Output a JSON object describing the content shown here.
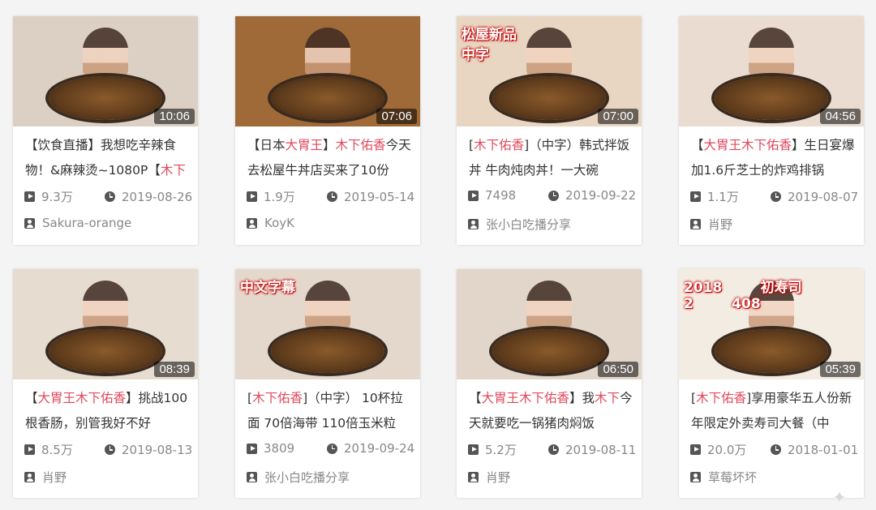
{
  "icons": {
    "views": "play-icon",
    "date": "clock-icon",
    "author": "user-icon"
  },
  "colors": {
    "highlight": "#e0475a",
    "text": "#333333",
    "meta": "#888888"
  },
  "videos": [
    {
      "thumb_bg": "#dcd0c4",
      "thumb_overlay": "",
      "duration": "10:06",
      "title_parts": [
        "【饮食直播】我想吃辛辣食物！&麻辣烫~1080P【",
        "木下",
        ""
      ],
      "views": "9.3万",
      "date": "2019-08-26",
      "author": "Sakura-orange"
    },
    {
      "thumb_bg": "#a06a38",
      "thumb_overlay": "",
      "duration": "07:06",
      "title_parts": [
        "【日本",
        "大胃王",
        "】",
        "木下佑香",
        "今天去松屋牛丼店买来了10份"
      ],
      "views": "1.9万",
      "date": "2019-05-14",
      "author": "KoyK"
    },
    {
      "thumb_bg": "#e8d6c2",
      "thumb_overlay": "松屋新品\n中字",
      "duration": "07:00",
      "title_parts": [
        "[",
        "木下佑香",
        "]（中字）韩式拌饭丼 牛肉炖肉丼！一大碗"
      ],
      "views": "7498",
      "date": "2019-09-22",
      "author": "张小白吃播分享"
    },
    {
      "thumb_bg": "#eadcd0",
      "thumb_overlay": "",
      "duration": "04:56",
      "title_parts": [
        "【",
        "大胃王木下佑香",
        "】生日宴爆加1.6斤芝士的炸鸡排锅"
      ],
      "views": "1.1万",
      "date": "2019-08-07",
      "author": "肖野"
    },
    {
      "thumb_bg": "#e6dccf",
      "thumb_overlay": "",
      "duration": "08:39",
      "title_parts": [
        "【",
        "大胃王木下佑香",
        "】挑战100根香肠，别管我好不好"
      ],
      "views": "8.5万",
      "date": "2019-08-13",
      "author": "肖野"
    },
    {
      "thumb_bg": "#e4d8cc",
      "thumb_overlay": "中文字幕",
      "duration": "",
      "title_parts": [
        "[",
        "木下佑香",
        "]（中字） 10杯拉面 70倍海带 110倍玉米粒"
      ],
      "views": "3809",
      "date": "2019-09-24",
      "author": "张小白吃播分享"
    },
    {
      "thumb_bg": "#e2d6ca",
      "thumb_overlay": "",
      "duration": "06:50",
      "title_parts": [
        "【",
        "大胃王木下佑香",
        "】我",
        "木下",
        "今天就要吃一锅猪肉焖饭"
      ],
      "views": "5.2万",
      "date": "2019-08-11",
      "author": "肖野"
    },
    {
      "thumb_bg": "#f3ece2",
      "thumb_overlay": "2018        初寿司\n2        408",
      "duration": "05:39",
      "title_parts": [
        "[",
        "木下佑香",
        "]享用豪华五人份新年限定外卖寿司大餐（中"
      ],
      "views": "20.0万",
      "date": "2018-01-01",
      "author": "草莓坏坏"
    }
  ]
}
